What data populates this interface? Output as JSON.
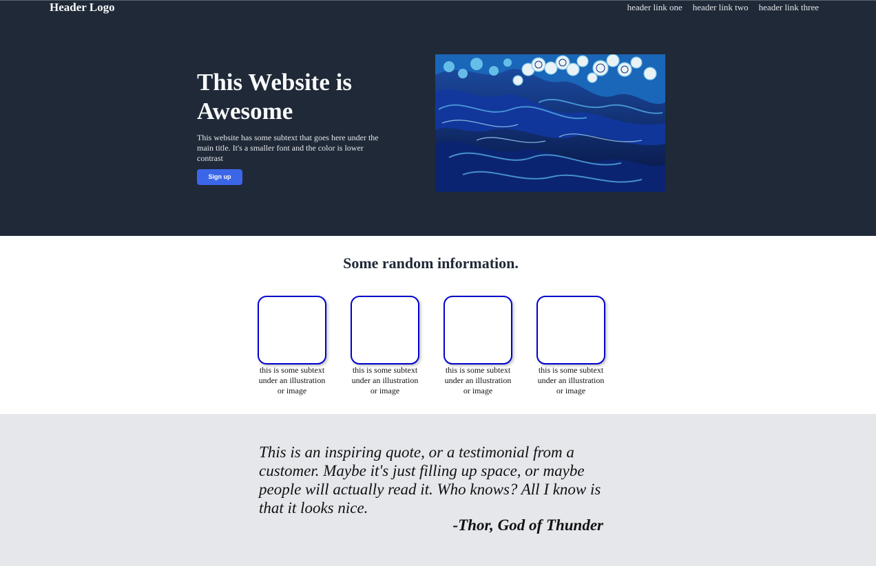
{
  "header": {
    "logo": "Header Logo",
    "links": [
      "header link one",
      "header link two",
      "header link three"
    ]
  },
  "hero": {
    "title": "This Website is Awesome",
    "subtitle": "This website has some subtext that goes here under the main title. It's a smaller font and the color is lower contrast",
    "button_label": "Sign up",
    "image_icon": "ocean-waves-painting"
  },
  "info": {
    "title": "Some random information.",
    "cards": [
      {
        "text": "this is some subtext under an illustration or image"
      },
      {
        "text": "this is some subtext under an illustration or image"
      },
      {
        "text": "this is some subtext under an illustration or image"
      },
      {
        "text": "this is some subtext under an illustration or image"
      }
    ]
  },
  "quote": {
    "text": "This is an inspiring quote, or a testimonial from a customer. Maybe it's just filling up space, or maybe people will actually read it. Who knows? All I know is that it looks nice.",
    "author": "-Thor, God of Thunder"
  },
  "colors": {
    "hero_background": "#1f2937",
    "button": "#3b66e8",
    "card_border": "#0000cc",
    "quote_background": "#e5e7eb"
  }
}
